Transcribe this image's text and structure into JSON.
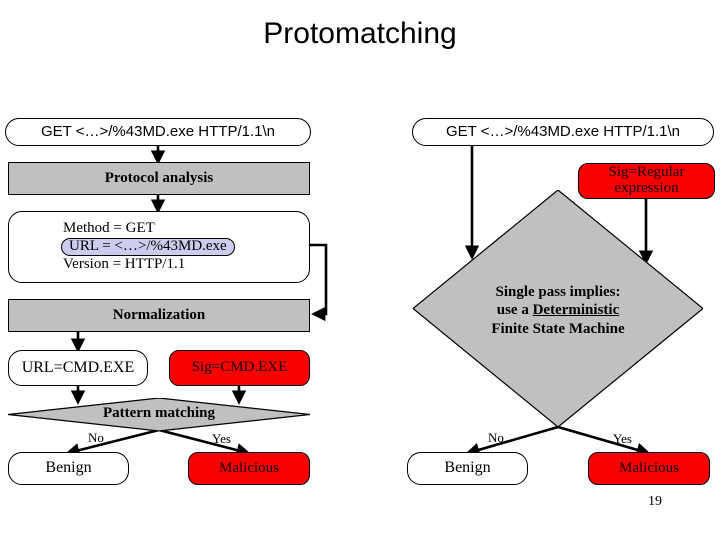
{
  "slide": {
    "title": "Protomatching",
    "number": "19",
    "background": "#ffffff"
  },
  "colors": {
    "process_fill": "#c0c0c0",
    "signature_fill": "#f80000",
    "highlight_fill": "#ccccee",
    "outline": "#000000",
    "text": "#000000"
  },
  "left_pipeline": {
    "request": "GET  <…>/%43MD.exe  HTTP/1.1\\n",
    "protocol_analysis": "Protocol analysis",
    "parsed_fields": {
      "method": "Method = GET",
      "url": "URL = <…>/%43MD.exe",
      "version": "Version = HTTP/1.1"
    },
    "normalization": "Normalization",
    "normalized_url": "URL=CMD.EXE",
    "signature": "Sig=CMD.EXE",
    "decision": "Pattern matching",
    "branch_no_label": "No",
    "branch_yes_label": "Yes",
    "outcome_benign": "Benign",
    "outcome_malicious": "Malicious"
  },
  "right_pipeline": {
    "request": "GET  <…>/%43MD.exe  HTTP/1.1\\n",
    "signature_line1": "Sig=Regular",
    "signature_line2": "expression",
    "decision_line1": "Single pass implies:",
    "decision_line2_prefix": "use a ",
    "decision_line2_underlined": "Deterministic",
    "decision_line3": "Finite State Machine",
    "branch_no_label": "No",
    "branch_yes_label": "Yes",
    "outcome_benign": "Benign",
    "outcome_malicious": "Malicious"
  }
}
